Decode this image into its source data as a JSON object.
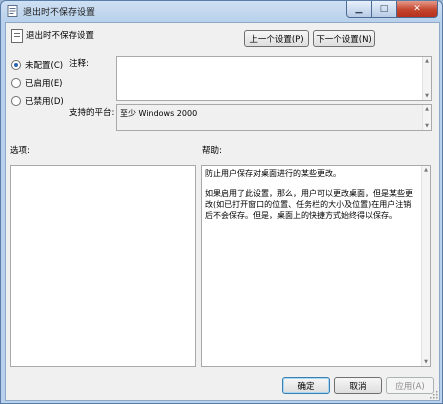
{
  "window": {
    "title": "退出时不保存设置"
  },
  "header": {
    "setting_name": "退出时不保存设置"
  },
  "nav": {
    "prev_label": "上一个设置(P)",
    "next_label": "下一个设置(N)"
  },
  "state": {
    "options": [
      {
        "label": "未配置(C)",
        "selected": true
      },
      {
        "label": "已启用(E)",
        "selected": false
      },
      {
        "label": "已禁用(D)",
        "selected": false
      }
    ]
  },
  "comment": {
    "label": "注释:",
    "value": ""
  },
  "platform": {
    "label": "支持的平台:",
    "value": "至少 Windows 2000"
  },
  "options_panel": {
    "label": "选项:"
  },
  "help": {
    "label": "帮助:",
    "paragraph1": "防止用户保存对桌面进行的某些更改。",
    "paragraph2": "如果启用了此设置，那么，用户可以更改桌面，但是某些更改(如已打开窗口的位置、任务栏的大小及位置)在用户注销后不会保存。但是，桌面上的快捷方式始终得以保存。"
  },
  "footer": {
    "ok_label": "确定",
    "cancel_label": "取消",
    "apply_label": "应用(A)"
  },
  "colors": {
    "titlebar": "#b9d1ec",
    "close_button": "#c4442c",
    "dialog_bg": "#f0f0f0",
    "radio_selected": "#2a67b5"
  }
}
